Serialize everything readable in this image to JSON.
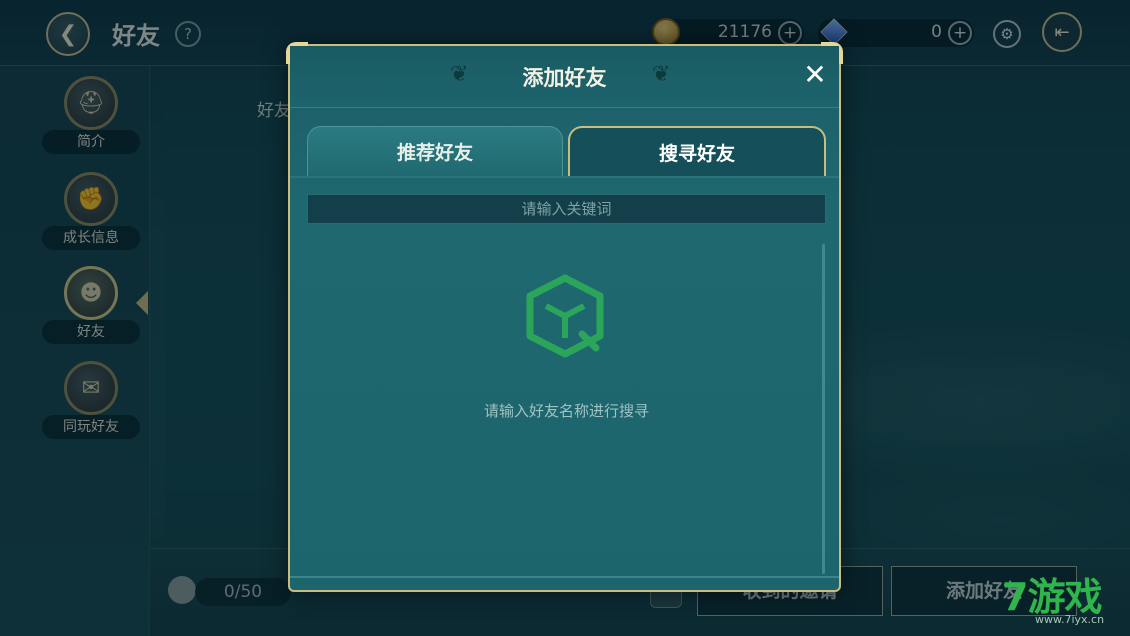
{
  "header": {
    "title": "好友",
    "back_icon": "back-arrow-icon",
    "help_label": "?"
  },
  "resources": {
    "gold": {
      "value": "21176",
      "plus_label": "+",
      "icon": "gold-coin-icon"
    },
    "gem": {
      "value": "0",
      "plus_label": "+",
      "icon": "blue-gem-icon"
    }
  },
  "sidebar": {
    "items": [
      {
        "label": "简介",
        "icon": "helmet-icon"
      },
      {
        "label": "成长信息",
        "icon": "fist-icon"
      },
      {
        "label": "好友",
        "icon": "friends-icon"
      },
      {
        "label": "同玩好友",
        "icon": "chat-icon"
      }
    ],
    "active_index": 2
  },
  "background_panel": {
    "tab_label": "好友"
  },
  "bottom": {
    "friend_count": "0/50",
    "invite_button": "收到的邀请",
    "add_friend_button": "添加好友"
  },
  "modal": {
    "title": "添加好友",
    "close_label": "✕",
    "tabs": [
      {
        "label": "推荐好友",
        "selected": false
      },
      {
        "label": "搜寻好友",
        "selected": true
      }
    ],
    "search_placeholder": "请输入关键词",
    "empty_message": "请输入好友名称进行搜寻"
  },
  "watermark": {
    "text": "7游戏",
    "url": "www.7iyx.cn"
  },
  "colors": {
    "accent_gold": "#c8bd7e",
    "modal_bg": "#1f6870",
    "empty_icon_green": "#2aa55a"
  }
}
